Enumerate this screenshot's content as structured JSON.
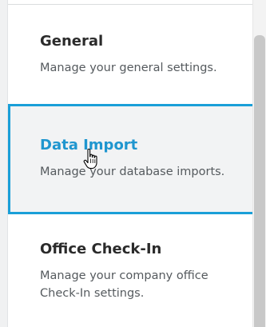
{
  "settings_menu": {
    "items": [
      {
        "title": "General",
        "description": "Manage your general settings.",
        "selected": false
      },
      {
        "title": "Data Import",
        "description": "Manage your database imports.",
        "selected": true
      },
      {
        "title": "Office Check-In",
        "description": "Manage your company office Check-In settings.",
        "selected": false
      }
    ]
  },
  "colors": {
    "accent": "#1a9fd8",
    "selected_title": "#1f96cf",
    "selected_background": "#f2f3f4",
    "title_text": "#2b2b2b",
    "description_text": "#555a5e"
  },
  "icons": {
    "cursor": "hand-pointer-icon"
  }
}
